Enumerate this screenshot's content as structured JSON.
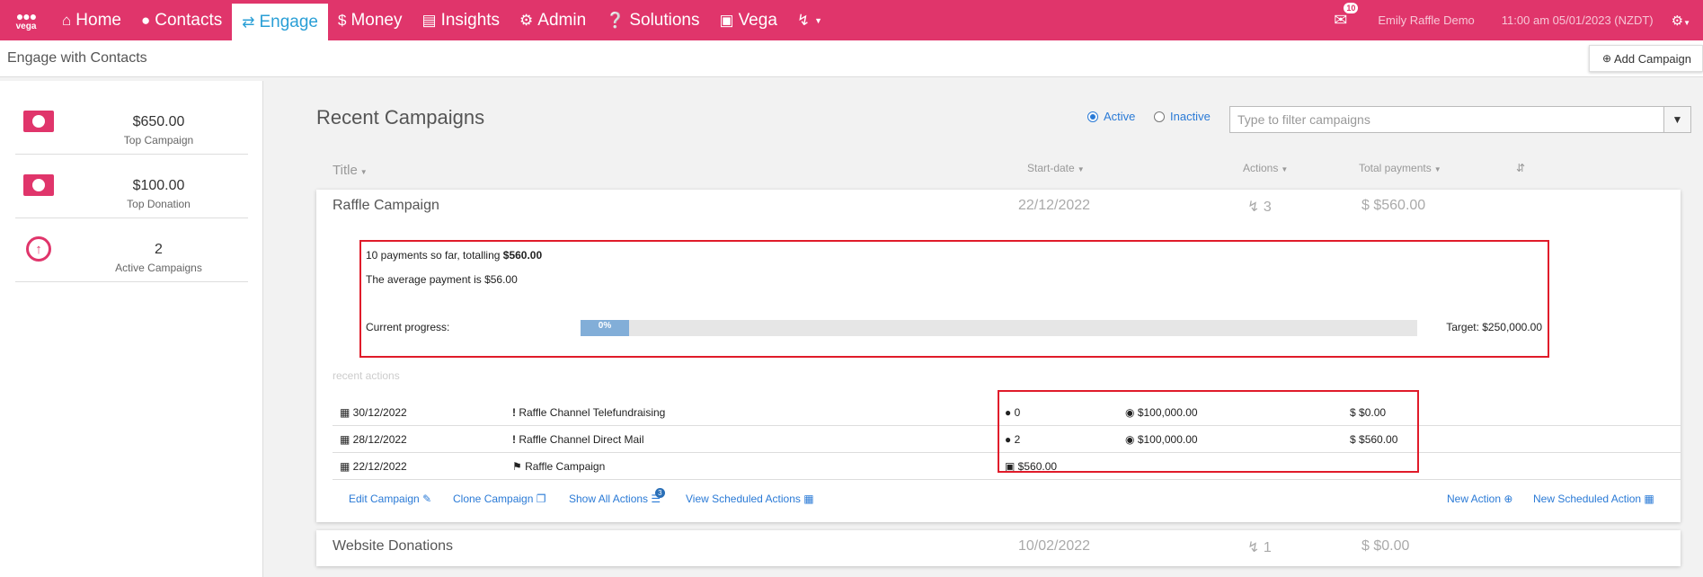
{
  "nav": {
    "logo_text": "vega",
    "items": [
      {
        "label": "Home",
        "icon": "home-icon"
      },
      {
        "label": "Contacts",
        "icon": "users-icon"
      },
      {
        "label": "Engage",
        "icon": "exchange-icon"
      },
      {
        "label": "Money",
        "icon": "dollar-icon"
      },
      {
        "label": "Insights",
        "icon": "bar-chart-icon"
      },
      {
        "label": "Admin",
        "icon": "cogs-icon"
      },
      {
        "label": "Solutions",
        "icon": "question-icon"
      },
      {
        "label": "Vega",
        "icon": "lock-icon"
      }
    ],
    "mail_count": "10",
    "user": "Emily Raffle Demo",
    "datetime": "11:00 am 05/01/2023 (NZDT)"
  },
  "subheader": {
    "title": "Engage with Contacts",
    "add_campaign": "Add Campaign"
  },
  "stats": [
    {
      "value": "$650.00",
      "label": "Top Campaign",
      "icon": "money-bill-icon"
    },
    {
      "value": "$100.00",
      "label": "Top Donation",
      "icon": "money-bill-icon"
    },
    {
      "value": "2",
      "label": "Active Campaigns",
      "icon": "arrow-circle-up-icon"
    }
  ],
  "main": {
    "title": "Recent Campaigns",
    "radio_active": "Active",
    "radio_inactive": "Inactive",
    "filter_placeholder": "Type to filter campaigns",
    "columns": {
      "title": "Title",
      "start": "Start-date",
      "actions": "Actions",
      "total": "Total payments"
    }
  },
  "campaign1": {
    "name": "Raffle Campaign",
    "date": "22/12/2022",
    "actions": "3",
    "total": "$560.00",
    "summary_prefix": "10 payments so far, totalling ",
    "summary_total": "$560.00",
    "average": "The average payment is $56.00",
    "progress_label": "Current progress:",
    "progress_pct": "0%",
    "target": "Target: $250,000.00",
    "recent_label": "recent actions",
    "rows": [
      {
        "date": "30/12/2022",
        "name": "Raffle Channel Telefundraising",
        "contacts": "0",
        "target": "$100,000.00",
        "amount": "$0.00"
      },
      {
        "date": "28/12/2022",
        "name": "Raffle Channel Direct Mail",
        "contacts": "2",
        "target": "$100,000.00",
        "amount": "$560.00"
      },
      {
        "date": "22/12/2022",
        "name": "Raffle Campaign",
        "payment": "$560.00"
      }
    ],
    "links": {
      "edit": "Edit Campaign",
      "clone": "Clone Campaign",
      "show_all": "Show All Actions",
      "show_all_count": "3",
      "view_scheduled": "View Scheduled Actions",
      "new_action": "New Action",
      "new_scheduled": "New Scheduled Action"
    }
  },
  "campaign2": {
    "name": "Website Donations",
    "date": "10/02/2022",
    "actions": "1",
    "total": "$0.00"
  },
  "colors": {
    "brand": "#e0356b",
    "link": "#2a7ad6",
    "highlight": "#e01b2a"
  }
}
